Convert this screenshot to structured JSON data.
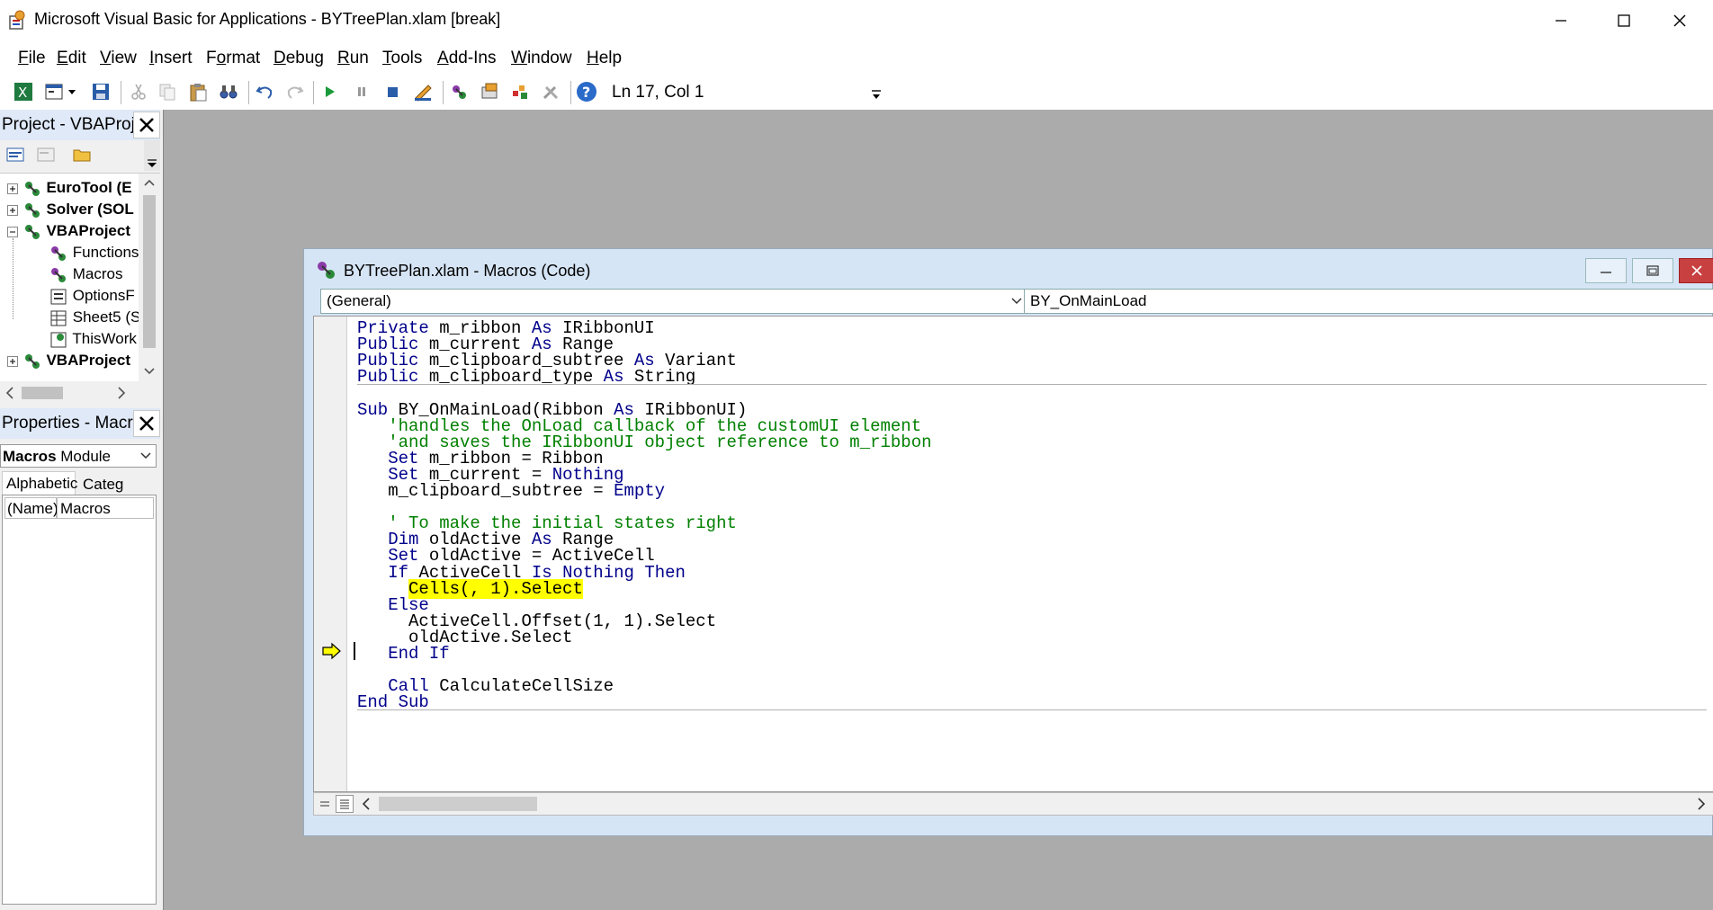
{
  "window": {
    "title": "Microsoft Visual Basic for Applications - BYTreePlan.xlam [break]"
  },
  "menu": [
    "File",
    "Edit",
    "View",
    "Insert",
    "Format",
    "Debug",
    "Run",
    "Tools",
    "Add-Ins",
    "Window",
    "Help"
  ],
  "menu_underline": [
    "F",
    "E",
    "V",
    "I",
    "o",
    "D",
    "R",
    "T",
    "A",
    "W",
    "H"
  ],
  "toolbar": {
    "position": "Ln 17, Col 1"
  },
  "project_panel": {
    "title": "Project - VBAProject",
    "items": [
      {
        "label": "EuroTool (E",
        "bold": true
      },
      {
        "label": "Solver (SOL",
        "bold": true
      },
      {
        "label": "VBAProject",
        "bold": true
      },
      {
        "label": "Functions",
        "bold": false
      },
      {
        "label": "Macros",
        "bold": false
      },
      {
        "label": "OptionsF",
        "bold": false
      },
      {
        "label": "Sheet5 (S",
        "bold": false
      },
      {
        "label": "ThisWork",
        "bold": false
      },
      {
        "label": "VBAProject",
        "bold": true
      }
    ]
  },
  "properties_panel": {
    "title": "Properties - Macros",
    "object_combo": "Macros Module",
    "object_combo_bold": "Macros",
    "object_combo_rest": " Module",
    "tabs": [
      "Alphabetic",
      "Categ"
    ],
    "row_name": "(Name)",
    "row_value": "Macros"
  },
  "code_window": {
    "title": "BYTreePlan.xlam - Macros (Code)",
    "object_combo": "(General)",
    "procedure_combo": "BY_OnMainLoad"
  },
  "code_lines": [
    "Private m_ribbon As IRibbonUI",
    "Public m_current As Range",
    "Public m_clipboard_subtree As Variant",
    "Public m_clipboard_type As String",
    "",
    "Sub BY_OnMainLoad(Ribbon As IRibbonUI)",
    "   'handles the OnLoad callback of the customUI element",
    "   'and saves the IRibbonUI object reference to m_ribbon",
    "   Set m_ribbon = Ribbon",
    "   Set m_current = Nothing",
    "   m_clipboard_subtree = Empty",
    "",
    "   ' To make the initial states right",
    "   Dim oldActive As Range",
    "   Set oldActive = ActiveCell",
    "   If ActiveCell Is Nothing Then",
    "     Cells(, 1).Select",
    "   Else",
    "     ActiveCell.Offset(1, 1).Select",
    "     oldActive.Select",
    "   End If",
    "",
    "   Call CalculateCellSize",
    "End Sub"
  ],
  "highlight_line": 17
}
